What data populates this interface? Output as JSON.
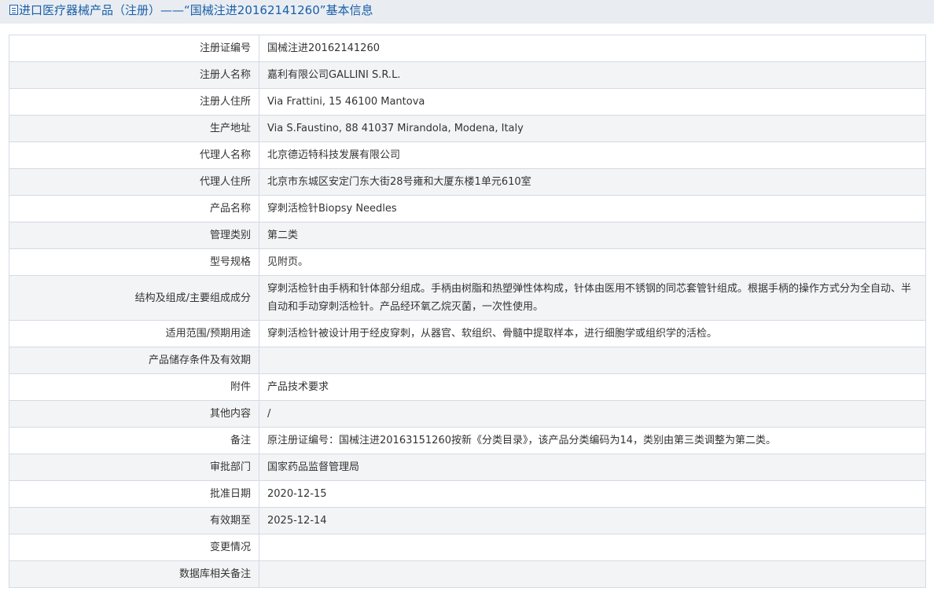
{
  "header": {
    "title": "进口医疗器械产品（注册）——“国械注进20162141260”基本信息",
    "icon": "document-icon"
  },
  "rows": [
    {
      "label": "注册证编号",
      "value": "国械注进20162141260"
    },
    {
      "label": "注册人名称",
      "value": "嘉利有限公司GALLINI S.R.L."
    },
    {
      "label": "注册人住所",
      "value": "Via Frattini, 15 46100 Mantova"
    },
    {
      "label": "生产地址",
      "value": "Via S.Faustino, 88 41037 Mirandola, Modena, Italy"
    },
    {
      "label": "代理人名称",
      "value": "北京德迈特科技发展有限公司"
    },
    {
      "label": "代理人住所",
      "value": "北京市东城区安定门东大街28号雍和大厦东楼1单元610室"
    },
    {
      "label": "产品名称",
      "value": "穿刺活检针Biopsy Needles"
    },
    {
      "label": "管理类别",
      "value": "第二类"
    },
    {
      "label": "型号规格",
      "value": "见附页。"
    },
    {
      "label": "结构及组成/主要组成成分",
      "value": "穿刺活检针由手柄和针体部分组成。手柄由树脂和热塑弹性体构成，针体由医用不锈钢的同芯套管针组成。根据手柄的操作方式分为全自动、半自动和手动穿刺活检针。产品经环氧乙烷灭菌，一次性使用。"
    },
    {
      "label": "适用范围/预期用途",
      "value": "穿刺活检针被设计用于经皮穿刺，从器官、软组织、骨髓中提取样本，进行细胞学或组织学的活检。"
    },
    {
      "label": "产品储存条件及有效期",
      "value": ""
    },
    {
      "label": "附件",
      "value": "产品技术要求"
    },
    {
      "label": "其他内容",
      "value": "/"
    },
    {
      "label": "备注",
      "value": "原注册证编号：国械注进20163151260按新《分类目录》，该产品分类编码为14，类别由第三类调整为第二类。"
    },
    {
      "label": "审批部门",
      "value": "国家药品监督管理局"
    },
    {
      "label": "批准日期",
      "value": "2020-12-15"
    },
    {
      "label": "有效期至",
      "value": "2025-12-14"
    },
    {
      "label": "变更情况",
      "value": ""
    },
    {
      "label": "数据库相关备注",
      "value": ""
    }
  ],
  "colors": {
    "header_bg": "#e9edf2",
    "header_text": "#1a5fa8",
    "border": "#d3dbe5",
    "stripe": "#f3f4f6"
  }
}
